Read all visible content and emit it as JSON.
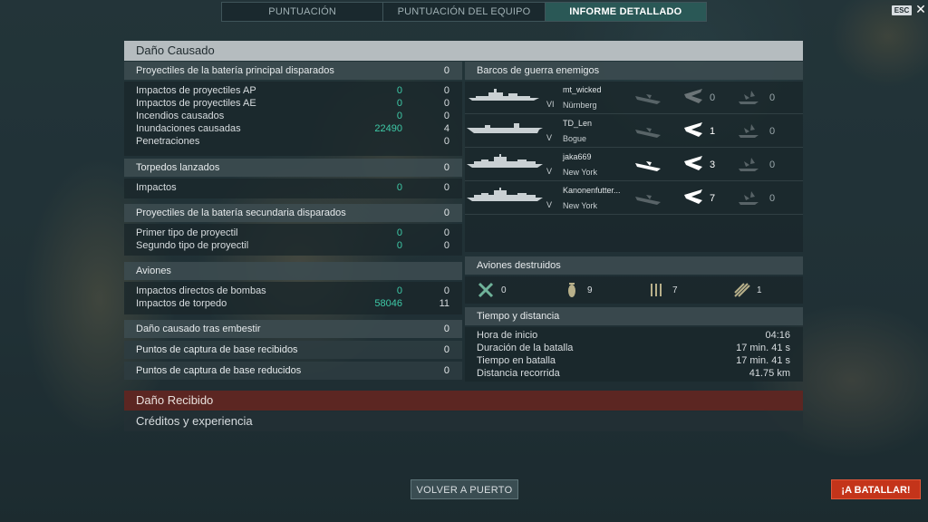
{
  "tabs": [
    {
      "label": "PUNTUACIÓN"
    },
    {
      "label": "PUNTUACIÓN DEL EQUIPO"
    },
    {
      "label": "INFORME DETALLADO"
    }
  ],
  "top": {
    "esc_label": "ESC",
    "close_glyph": "✕"
  },
  "damage_dealt": {
    "title": "Daño Causado",
    "main_battery": {
      "label": "Proyectiles de la batería principal disparados",
      "value": "0",
      "rows": [
        {
          "label": "Impactos de proyectiles AP",
          "dmg": "0",
          "value": "0"
        },
        {
          "label": "Impactos de proyectiles AE",
          "dmg": "0",
          "value": "0"
        },
        {
          "label": "Incendios causados",
          "dmg": "0",
          "value": "0"
        },
        {
          "label": "Inundaciones causadas",
          "dmg": "22490",
          "value": "4"
        },
        {
          "label": "Penetraciones",
          "dmg": "",
          "value": "0"
        }
      ]
    },
    "torpedoes": {
      "label": "Torpedos lanzados",
      "value": "0",
      "rows": [
        {
          "label": "Impactos",
          "dmg": "0",
          "value": "0"
        }
      ]
    },
    "secondary": {
      "label": "Proyectiles de la batería secundaria disparados",
      "value": "0",
      "rows": [
        {
          "label": "Primer tipo de proyectil",
          "dmg": "0",
          "value": "0"
        },
        {
          "label": "Segundo tipo de proyectil",
          "dmg": "0",
          "value": "0"
        }
      ]
    },
    "aircraft": {
      "label": "Aviones",
      "rows": [
        {
          "label": "Impactos directos de bombas",
          "dmg": "0",
          "value": "0"
        },
        {
          "label": "Impactos de torpedo",
          "dmg": "58046",
          "value": "11"
        }
      ]
    },
    "ramming": {
      "label": "Daño causado tras embestir",
      "value": "0"
    },
    "cap_received": {
      "label": "Puntos de captura de base recibidos",
      "value": "0"
    },
    "cap_reduced": {
      "label": "Puntos de captura de base reducidos",
      "value": "0"
    }
  },
  "enemy_ships": {
    "title": "Barcos de guerra enemigos",
    "ships": [
      {
        "player": "mt_wicked",
        "ship": "Nürnberg",
        "tier": "VI",
        "cnt2": "0",
        "cnt3": "0",
        "active1": false,
        "active2": false
      },
      {
        "player": "TD_Len",
        "ship": "Bogue",
        "tier": "V",
        "cnt2": "1",
        "cnt3": "0",
        "active1": false,
        "active2": true
      },
      {
        "player": "jaka669",
        "ship": "New York",
        "tier": "V",
        "cnt2": "3",
        "cnt3": "0",
        "active1": true,
        "active2": true
      },
      {
        "player": "Kanonenfutter...",
        "ship": "New York",
        "tier": "V",
        "cnt2": "7",
        "cnt3": "0",
        "active1": false,
        "active2": true
      }
    ]
  },
  "planes_destroyed": {
    "title": "Aviones destruidos",
    "items": [
      {
        "icon": "fighter-icon",
        "value": "0"
      },
      {
        "icon": "bomb-icon",
        "value": "9"
      },
      {
        "icon": "torpedo-bomber-icon",
        "value": "7"
      },
      {
        "icon": "dive-bomber-icon",
        "value": "1"
      }
    ]
  },
  "time_distance": {
    "title": "Tiempo y distancia",
    "rows": [
      {
        "label": "Hora de inicio",
        "value": "04:16"
      },
      {
        "label": "Duración de la batalla",
        "value": "17 min. 41 s"
      },
      {
        "label": "Tiempo en batalla",
        "value": "17 min. 41 s"
      },
      {
        "label": "Distancia recorrida",
        "value": "41.75 km"
      }
    ]
  },
  "damage_received": {
    "title": "Daño Recibido"
  },
  "credits_xp": {
    "title": "Créditos y experiencia"
  },
  "buttons": {
    "home": "VOLVER A PUERTO",
    "battle": "¡A BATALLAR!"
  }
}
